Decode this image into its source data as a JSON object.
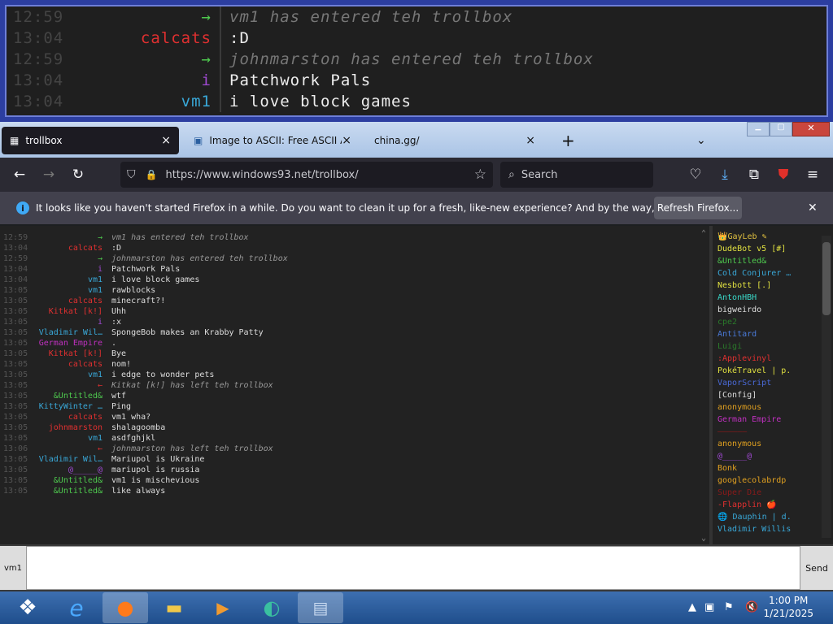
{
  "zoom_rows": [
    {
      "time": "12:59",
      "name": "→",
      "name_color": "#4ec94e",
      "msg": "vm1 has entered teh trollbox",
      "sys": true,
      "msg_color": "#777"
    },
    {
      "time": "13:04",
      "name": "calcats",
      "name_color": "#e03030",
      "msg": ":D",
      "sys": false,
      "msg_color": "#eee"
    },
    {
      "time": "12:59",
      "name": "→",
      "name_color": "#4ec94e",
      "msg": "johnmarston has entered teh trollbox",
      "sys": true,
      "msg_color": "#777"
    },
    {
      "time": "13:04",
      "name": "i",
      "name_color": "#a24ad6",
      "msg": "Patchwork Pals",
      "sys": false,
      "msg_color": "#eee"
    },
    {
      "time": "13:04",
      "name": "vm1",
      "name_color": "#39a8d8",
      "msg": "i love block games",
      "sys": false,
      "msg_color": "#eee"
    }
  ],
  "tabs": [
    {
      "label": "trollbox",
      "close": "×"
    },
    {
      "label": "Image to ASCII: Free ASCII Art C",
      "close": "×"
    },
    {
      "label": "china.gg/",
      "close": "×"
    }
  ],
  "new_tab": "+",
  "window_controls": {
    "minimize": "▁",
    "maximize": "▢",
    "close": "✕"
  },
  "url": "https://www.windows93.net/trollbox/",
  "search_placeholder": "Search",
  "notice": {
    "text": "It looks like you haven't started Firefox in a while. Do you want to clean it up for a fresh, like-new experience? And by the way, welcome back!",
    "button": "Refresh Firefox...",
    "close": "✕"
  },
  "chat": [
    {
      "time": "12:59",
      "name": "→",
      "color": "#4ec94e",
      "msg": "vm1 has entered teh trollbox",
      "sys": true
    },
    {
      "time": "13:04",
      "name": "calcats",
      "color": "#e03030",
      "msg": ":D",
      "sys": false
    },
    {
      "time": "12:59",
      "name": "→",
      "color": "#4ec94e",
      "msg": "johnmarston has entered teh trollbox",
      "sys": true
    },
    {
      "time": "13:04",
      "name": "i",
      "color": "#a24ad6",
      "msg": "Patchwork Pals",
      "sys": false
    },
    {
      "time": "13:04",
      "name": "vm1",
      "color": "#39a8d8",
      "msg": "i love block games",
      "sys": false
    },
    {
      "time": "13:05",
      "name": "vm1",
      "color": "#39a8d8",
      "msg": "rawblocks",
      "sys": false
    },
    {
      "time": "13:05",
      "name": "calcats",
      "color": "#e03030",
      "msg": "minecraft?!",
      "sys": false
    },
    {
      "time": "13:05",
      "name": "Kitkat [k!]",
      "color": "#e03030",
      "msg": "Uhh",
      "sys": false
    },
    {
      "time": "13:05",
      "name": "i",
      "color": "#a24ad6",
      "msg": ":x",
      "sys": false
    },
    {
      "time": "13:05",
      "name": "Vladimir Wil…",
      "color": "#39a8d8",
      "msg": "SpongeBob makes an Krabby Patty",
      "sys": false
    },
    {
      "time": "13:05",
      "name": "German Empire",
      "color": "#c030c0",
      "msg": ".",
      "sys": false
    },
    {
      "time": "13:05",
      "name": "Kitkat [k!]",
      "color": "#e03030",
      "msg": "Bye",
      "sys": false
    },
    {
      "time": "13:05",
      "name": "calcats",
      "color": "#e03030",
      "msg": "nom!",
      "sys": false
    },
    {
      "time": "13:05",
      "name": "vm1",
      "color": "#39a8d8",
      "msg": "i edge to wonder pets",
      "sys": false
    },
    {
      "time": "13:05",
      "name": "←",
      "color": "#e03030",
      "msg": "Kitkat [k!] has left teh trollbox",
      "sys": true
    },
    {
      "time": "13:05",
      "name": "&Untitled&",
      "color": "#4ec94e",
      "msg": "wtf",
      "sys": false
    },
    {
      "time": "13:05",
      "name": "KittyWinter …",
      "color": "#39a8d8",
      "msg": "Ping",
      "sys": false
    },
    {
      "time": "13:05",
      "name": "calcats",
      "color": "#e03030",
      "msg": "vm1 wha?",
      "sys": false
    },
    {
      "time": "13:05",
      "name": "johnmarston",
      "color": "#e03030",
      "msg": "shalagoomba",
      "sys": false
    },
    {
      "time": "13:05",
      "name": "vm1",
      "color": "#39a8d8",
      "msg": "asdfghjkl",
      "sys": false
    },
    {
      "time": "13:06",
      "name": "←",
      "color": "#e03030",
      "msg": "johnmarston has left teh trollbox",
      "sys": true
    },
    {
      "time": "13:05",
      "name": "Vladimir Wil…",
      "color": "#39a8d8",
      "msg": "Mariupol is Ukraine",
      "sys": false
    },
    {
      "time": "13:05",
      "name": "@_____@",
      "color": "#a24ad6",
      "msg": "mariupol is russia",
      "sys": false
    },
    {
      "time": "13:05",
      "name": "&Untitled&",
      "color": "#4ec94e",
      "msg": "vm1 is mischevious",
      "sys": false
    },
    {
      "time": "13:05",
      "name": "&Untitled&",
      "color": "#4ec94e",
      "msg": "like always",
      "sys": false
    }
  ],
  "users": [
    {
      "name": "👑GayLeb ✎",
      "color": "#e0c040"
    },
    {
      "name": "DudeBot v5 [#]",
      "color": "#e0e040"
    },
    {
      "name": "&Untitled&",
      "color": "#4ec94e"
    },
    {
      "name": "Cold Conjurer …",
      "color": "#39a8d8"
    },
    {
      "name": "Nesbott [.]",
      "color": "#e0e040"
    },
    {
      "name": "AntonHBH",
      "color": "#39d8c8"
    },
    {
      "name": "bigweirdo",
      "color": "#dddddd"
    },
    {
      "name": "cpe2",
      "color": "#2a7a2a"
    },
    {
      "name": "Antitard",
      "color": "#4a7ad8"
    },
    {
      "name": "Luigi",
      "color": "#2a7a2a"
    },
    {
      "name": ":Applevinyl",
      "color": "#e03030"
    },
    {
      "name": "PokéTravel | p.",
      "color": "#e0e040"
    },
    {
      "name": "VaporScript",
      "color": "#4a6ad8"
    },
    {
      "name": "[Config]",
      "color": "#dddddd"
    },
    {
      "name": "anonymous",
      "color": "#e0a020"
    },
    {
      "name": "German Empire",
      "color": "#c030c0"
    },
    {
      "name": "——————",
      "color": "#8a1a1a"
    },
    {
      "name": "anonymous",
      "color": "#e0a020"
    },
    {
      "name": "@_____@",
      "color": "#a24ad6"
    },
    {
      "name": "Bonk",
      "color": "#e0a020"
    },
    {
      "name": "googlecolabrdp",
      "color": "#e0a020"
    },
    {
      "name": "Super Die",
      "color": "#8a1a1a"
    },
    {
      "name": "-Flapplin 🍎",
      "color": "#e03030"
    },
    {
      "name": "🌐 Dauphin | d.",
      "color": "#39a8d8"
    },
    {
      "name": "Vladimir Willis",
      "color": "#39a8d8"
    }
  ],
  "input": {
    "nick": "vm1",
    "send": "Send"
  },
  "clock": {
    "time": "1:00 PM",
    "date": "1/21/2025"
  }
}
